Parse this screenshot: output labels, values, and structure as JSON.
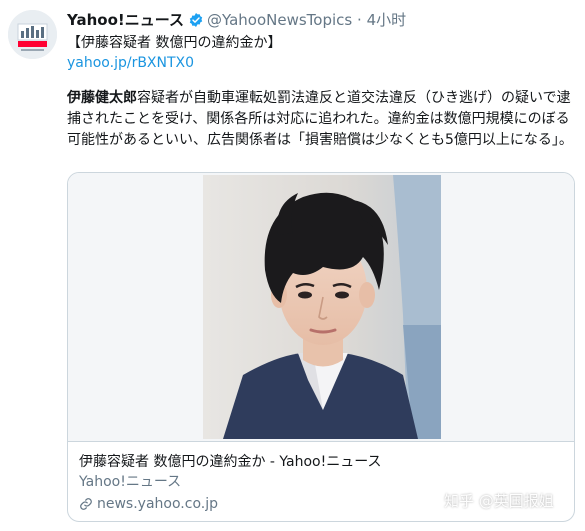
{
  "tweet": {
    "author_name": "Yahoo!ニュース",
    "handle": "@YahooNewsTopics",
    "separator": "·",
    "time": "4小时",
    "headline": "【伊藤容疑者 数億円の違約金か】",
    "short_link": "yahoo.jp/rBXNTX0",
    "body_bold": "伊藤健太郎",
    "body_rest": "容疑者が自動車運転処罰法違反と道交法違反（ひき逃げ）の疑いで逮捕されたことを受け、関係各所は対応に追われた。違約金は数億円規模にのぼる可能性があるといい、広告関係者は「損害賠償は少なくとも5億円以上になる」。"
  },
  "card": {
    "title": "伊藤容疑者 数億円の違約金か - Yahoo!ニュース",
    "description": "Yahoo!ニュース",
    "domain": "news.yahoo.co.jp"
  },
  "watermark": "知乎 @英国报姐",
  "icons": {
    "verified": "verified-badge-icon",
    "link": "link-icon",
    "avatar": "yahoo-news-logo"
  },
  "colors": {
    "link": "#1b95e0",
    "muted": "#657786",
    "border": "#ccd6dd",
    "verified": "#1da1f2"
  }
}
